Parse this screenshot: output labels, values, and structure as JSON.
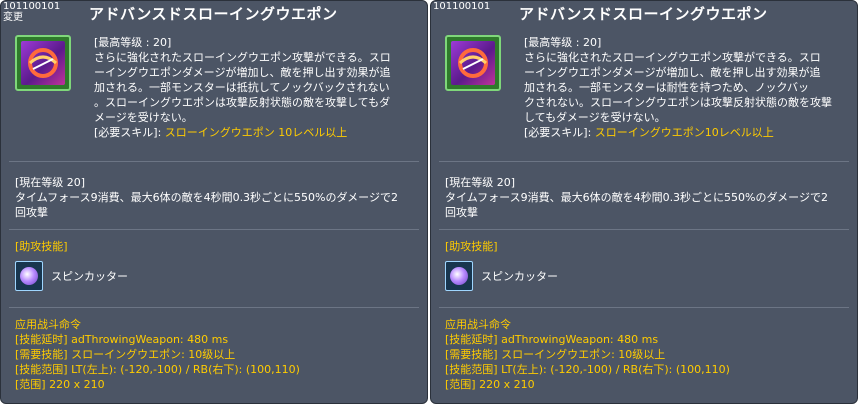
{
  "tooltips": [
    {
      "skill_id": "101100101",
      "changed_label": "変更",
      "title": "アドバンスドスローイングウエポン",
      "max_level": "[最高等级 : 20]",
      "desc_lines": [
        "さらに強化されたスローイングウエポン攻撃ができる。スロ",
        "ーイングウエポンダメージが増加し、敵を押し出す効果が追",
        "加される。一部モンスターは抵抗してノックバックされない",
        "。スローイングウエポンは攻撃反射状態の敵を攻撃してもダ",
        "メージを受けない。"
      ],
      "req_label": "[必要スキル]: ",
      "req_value": "スローイングウエポン 10レベル以上",
      "current_level": "[現在等级 20]",
      "current_lines": [
        "タイムフォース9消費、最大6体の敵を4秒間0.3秒ごとに550%のダメージで2",
        "回攻撃"
      ],
      "assist_header": "[助攻技能]",
      "assist_skill": "スピンカッター",
      "combat_lines": [
        "应用战斗命令",
        "[技能延时] adThrowingWeapon: 480 ms",
        "[需要技能] スローイングウエポン: 10级以上",
        "[技能范围] LT(左上): (-120,-100) / RB(右下): (100,110)",
        "[范围] 220 x 210"
      ]
    },
    {
      "skill_id": "101100101",
      "changed_label": "",
      "title": "アドバンスドスローイングウエポン",
      "max_level": "[最高等级 : 20]",
      "desc_lines": [
        "さらに強化されたスローイングウエポン攻撃ができる。スロ",
        "ーイングウエポンダメージが増加し、敵を押し出す効果が追",
        "加される。一部モンスターは耐性を持つため、ノックバッ",
        "クされない。スローイングウエポンは攻撃反射状態の敵を攻撃",
        "してもダメージを受けない。"
      ],
      "req_label": "[必要スキル]: ",
      "req_value": "スローイングウエポン10レベル以上",
      "current_level": "[現在等级 20]",
      "current_lines": [
        "タイムフォース9消費、最大6体の敵を4秒間0.3秒ごとに550%のダメージで2",
        "回攻撃"
      ],
      "assist_header": "[助攻技能]",
      "assist_skill": "スピンカッター",
      "combat_lines": [
        "应用战斗命令",
        "[技能延时] adThrowingWeapon: 480 ms",
        "[需要技能] スローイングウエポン: 10级以上",
        "[技能范围] LT(左上): (-120,-100) / RB(右下): (100,110)",
        "[范围] 220 x 210"
      ]
    }
  ]
}
